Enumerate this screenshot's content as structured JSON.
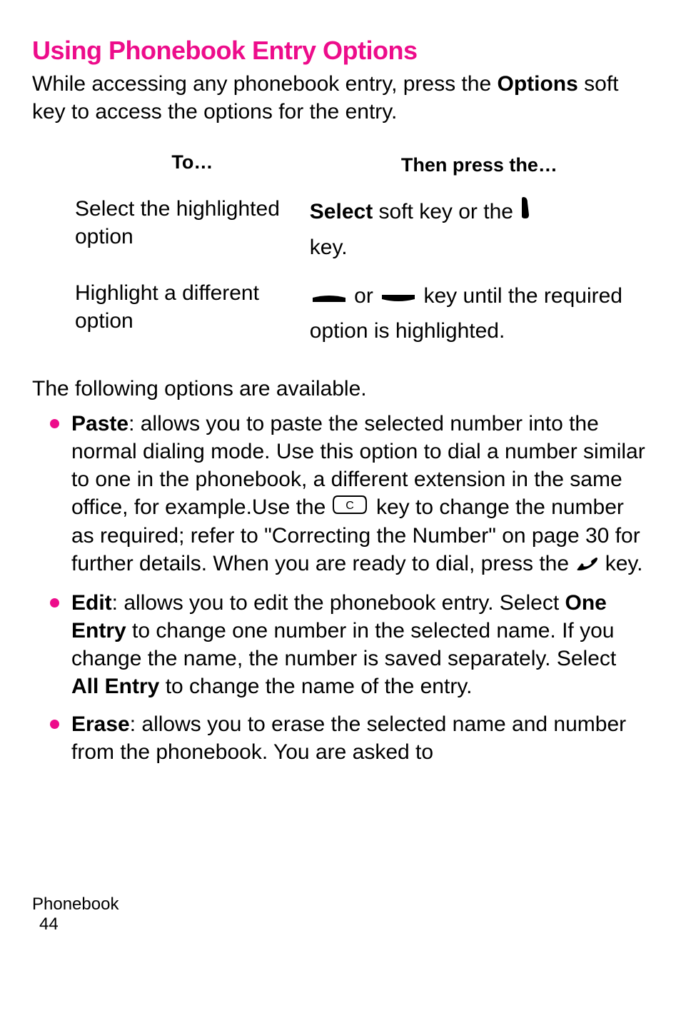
{
  "heading": "Using Phonebook Entry Options",
  "intro_part1": "While accessing any phonebook entry, press the ",
  "intro_bold": "Options",
  "intro_part2": " soft key to access the options for the entry.",
  "table": {
    "header_to": "To…",
    "header_then": "Then press the…",
    "rows": [
      {
        "left": "Select the highlighted option",
        "right_bold": "Select",
        "right_part2": " soft key or the ",
        "right_part3": "key."
      },
      {
        "left": "Highlight a different option",
        "right_part1": " or ",
        "right_part2": " key until the required option is highlighted."
      }
    ]
  },
  "options_intro": "The following options are available.",
  "bullets": [
    {
      "label": "Paste",
      "text1": ": allows you to paste the selected number into the normal dialing mode. Use this option to dial a number similar to one in the phonebook, a different extension in the same office, for example.Use the ",
      "text2": " key to change the number as required; refer to \"Correcting the Number\" on page 30 for further details. When you are ready to dial, press the ",
      "text3": " key."
    },
    {
      "label": "Edit",
      "text1": ": allows you to edit the phonebook entry. Select ",
      "bold2": "One Entry",
      "text2": " to change one number in the selected name. If you change the name, the number is saved separately. Select ",
      "bold3": "All Entry",
      "text3": " to change the name of the entry."
    },
    {
      "label": "Erase",
      "text1": ": allows you to erase the selected name and number from the phonebook. You are asked to"
    }
  ],
  "footer": {
    "section": "Phonebook",
    "page": "44"
  },
  "icons": {
    "phone_key": "phone-receiver-icon",
    "nav_up": "nav-up-icon",
    "nav_down": "nav-down-icon",
    "c_key": "c-key-icon",
    "call_key": "call-icon"
  }
}
